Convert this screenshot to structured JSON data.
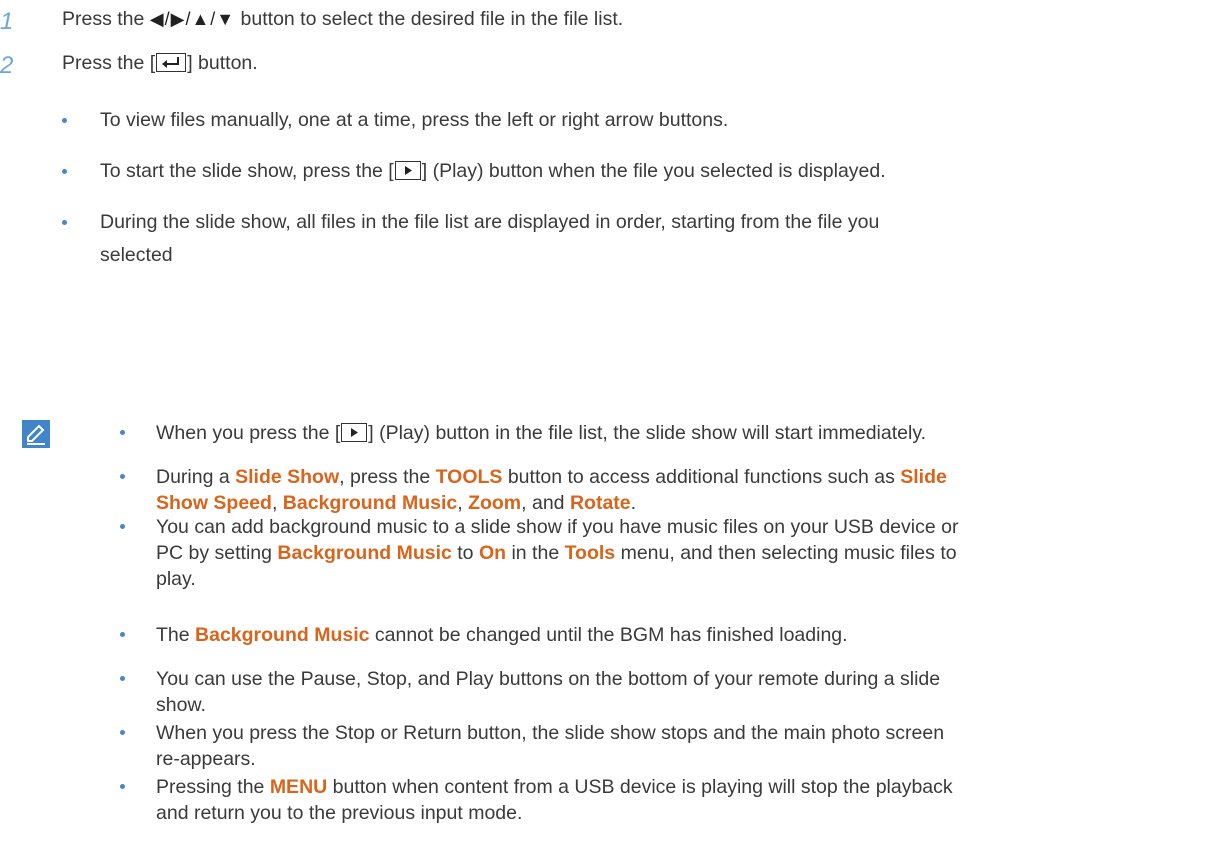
{
  "steps": [
    {
      "num": "1",
      "pre": "Press the ",
      "arrows": "◀/▶/▲/▼",
      "post": " button to select the desired file in the file list."
    },
    {
      "num": "2",
      "pre": "Press the [",
      "post": "] button."
    }
  ],
  "step_bullets": [
    "To view files manually, one at a time, press the left or right arrow buttons.",
    {
      "pre": "To start the slide show, press the [",
      "post": "] (Play) button when the file you selected is displayed."
    },
    {
      "line1": "During the slide show, all files in the file list are displayed in order, starting from the file you",
      "line2": "selected"
    }
  ],
  "notes": {
    "n1": {
      "pre": "When you press the [",
      "post": "] (Play) button in the file list, the slide show will start immediately."
    },
    "n2": {
      "a": "During a ",
      "b": "Slide Show",
      "c": ", press the ",
      "d": "TOOLS",
      "e": " button to access additional functions such as ",
      "f": "Slide",
      "g": "Show Speed",
      "h": ", ",
      "i": "Background Music",
      "j": ", ",
      "k": "Zoom",
      "l": ", and ",
      "m": "Rotate",
      "n": "."
    },
    "n3": {
      "a": "You can add background music to a slide show if you have music files on your USB device or",
      "b": "PC by setting ",
      "c": "Background Music",
      "d": " to ",
      "e": "On",
      "f": " in the ",
      "g": "Tools",
      "h": " menu, and then selecting music files to",
      "i": "play."
    },
    "n4": {
      "a": "The ",
      "b": "Background Music",
      "c": " cannot be changed until the BGM has finished loading."
    },
    "n5": {
      "a": "You can use the Pause, Stop, and Play buttons on the bottom of your remote during a slide",
      "b": "show."
    },
    "n6": {
      "a": "When you press the Stop or Return button, the slide show stops and the main photo screen",
      "b": "re-appears."
    },
    "n7": {
      "a": "Pressing the ",
      "b": "MENU",
      "c": " button when content from a USB device is playing will stop the playback",
      "d": "and return you to the previous input mode."
    }
  },
  "icons": {
    "note": "note-pencil-icon",
    "enter": "enter-key-icon",
    "play": "play-key-icon"
  },
  "colors": {
    "keyword": "#d9651c",
    "step_number": "#6fa6da",
    "bullet": "#4a86c5",
    "note_icon": "#3f85c8"
  }
}
